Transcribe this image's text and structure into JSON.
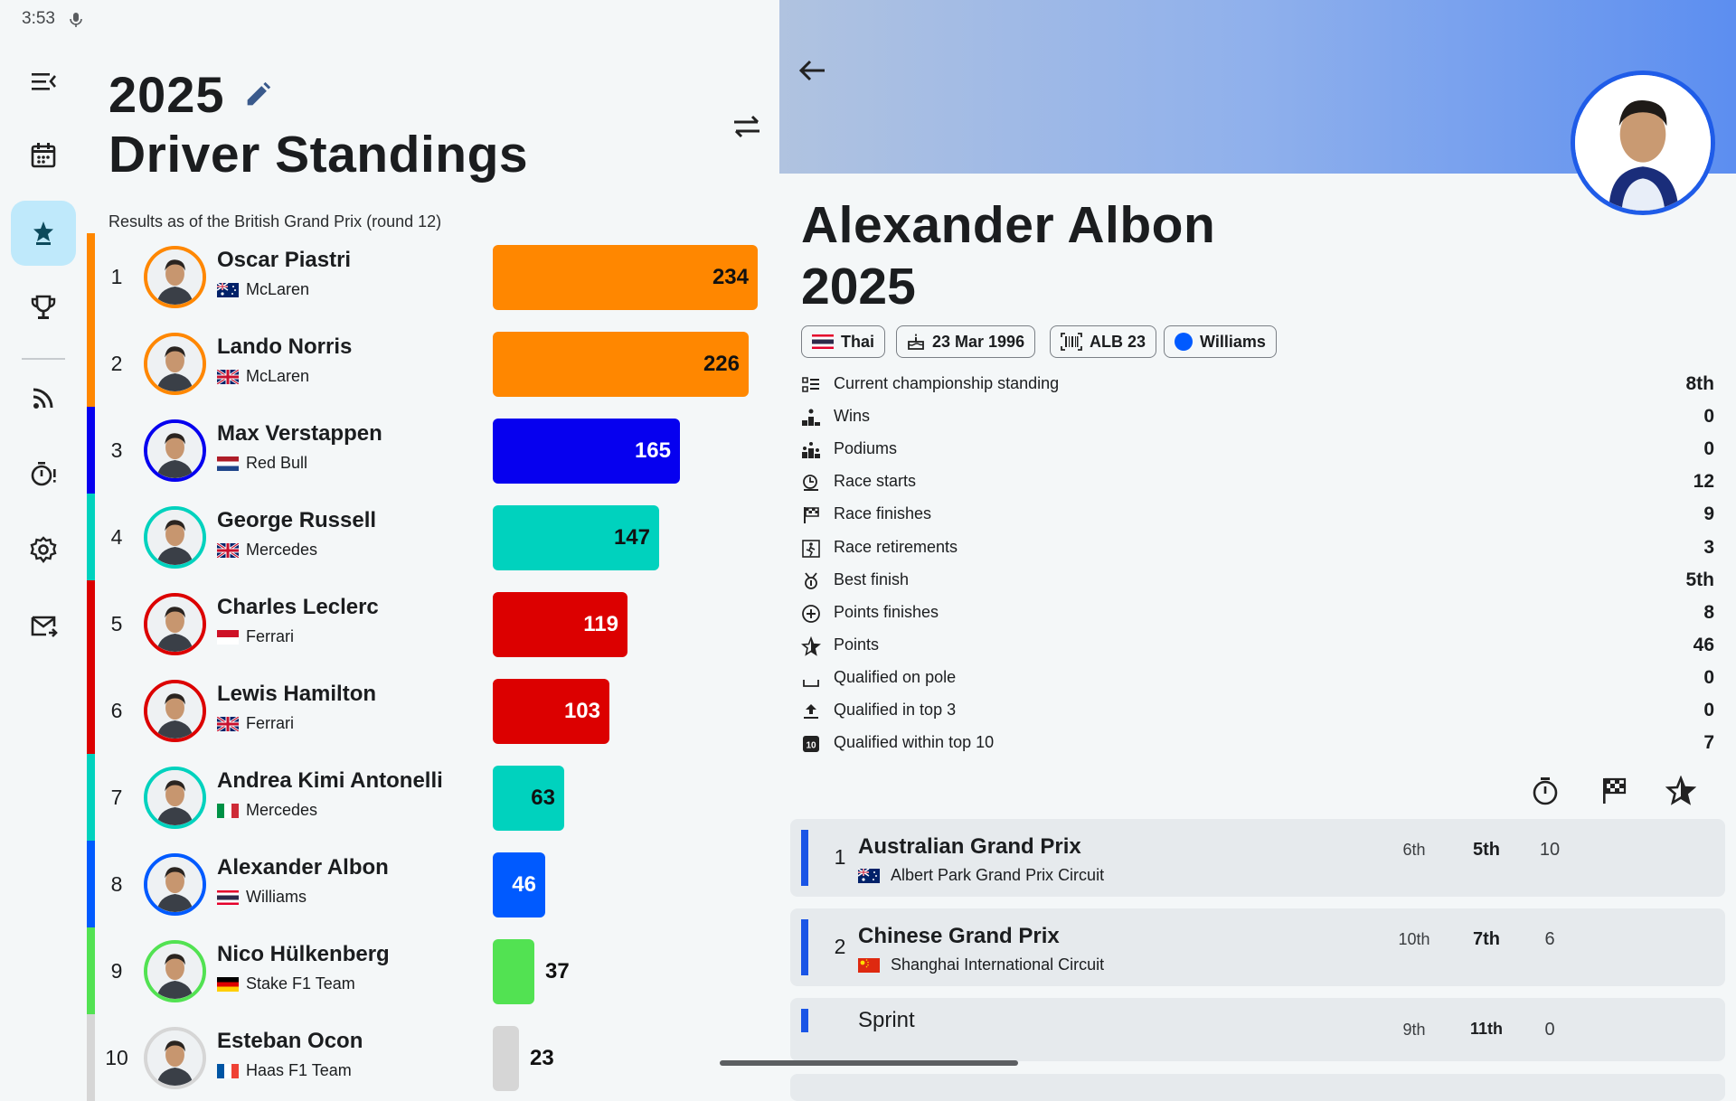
{
  "status_bar": {
    "time": "3:53"
  },
  "navigation": {
    "items": [
      "menu",
      "calendar",
      "standings",
      "trophy",
      "feed",
      "timer",
      "settings",
      "mail"
    ],
    "active": "standings"
  },
  "standings": {
    "year": "2025",
    "title": "Driver Standings",
    "results_note": "Results as of the British Grand Prix (round 12)",
    "rows": [
      {
        "pos": "1",
        "name": "Oscar Piastri",
        "team": "McLaren",
        "flag": "AU",
        "points": "234",
        "color": "#ff8700",
        "label_inside": true
      },
      {
        "pos": "2",
        "name": "Lando Norris",
        "team": "McLaren",
        "flag": "GB",
        "points": "226",
        "color": "#ff8700",
        "label_inside": true
      },
      {
        "pos": "3",
        "name": "Max Verstappen",
        "team": "Red Bull",
        "flag": "NL",
        "points": "165",
        "color": "#0600ef",
        "label_inside": true
      },
      {
        "pos": "4",
        "name": "George Russell",
        "team": "Mercedes",
        "flag": "GB",
        "points": "147",
        "color": "#00d2be",
        "label_inside": true
      },
      {
        "pos": "5",
        "name": "Charles Leclerc",
        "team": "Ferrari",
        "flag": "MC",
        "points": "119",
        "color": "#dc0000",
        "label_inside": true
      },
      {
        "pos": "6",
        "name": "Lewis Hamilton",
        "team": "Ferrari",
        "flag": "GB",
        "points": "103",
        "color": "#dc0000",
        "label_inside": true
      },
      {
        "pos": "7",
        "name": "Andrea Kimi Antonelli",
        "team": "Mercedes",
        "flag": "IT",
        "points": "63",
        "color": "#00d2be",
        "label_inside": true
      },
      {
        "pos": "8",
        "name": "Alexander Albon",
        "team": "Williams",
        "flag": "TH",
        "points": "46",
        "color": "#005aff",
        "label_inside": true
      },
      {
        "pos": "9",
        "name": "Nico Hülkenberg",
        "team": "Stake F1 Team",
        "flag": "DE",
        "points": "37",
        "color": "#52e252",
        "label_inside": false
      },
      {
        "pos": "10",
        "name": "Esteban Ocon",
        "team": "Haas F1 Team",
        "flag": "FR",
        "points": "23",
        "color": "#d6d6d6",
        "label_inside": false
      }
    ]
  },
  "driver": {
    "name": "Alexander Albon",
    "year": "2025",
    "chips": [
      {
        "label": "Thai",
        "icon": "thailand-flag-icon"
      },
      {
        "label": "23 Mar 1996",
        "icon": "cake-icon"
      },
      {
        "label": "ALB 23",
        "icon": "barcode-icon"
      },
      {
        "label": "Williams",
        "icon": "team-color-dot",
        "color": "#005aff"
      }
    ],
    "stats": [
      {
        "label": "Current championship standing",
        "value": "8th"
      },
      {
        "label": "Wins",
        "value": "0"
      },
      {
        "label": "Podiums",
        "value": "0"
      },
      {
        "label": "Race starts",
        "value": "12"
      },
      {
        "label": "Race finishes",
        "value": "9"
      },
      {
        "label": "Race retirements",
        "value": "3"
      },
      {
        "label": "Best finish",
        "value": "5th"
      },
      {
        "label": "Points finishes",
        "value": "8"
      },
      {
        "label": "Points",
        "value": "46"
      },
      {
        "label": "Qualified on pole",
        "value": "0"
      },
      {
        "label": "Qualified in top 3",
        "value": "0"
      },
      {
        "label": "Qualified within top 10",
        "value": "7"
      }
    ],
    "races": [
      {
        "round": "1",
        "name": "Australian Grand Prix",
        "circuit": "Albert Park Grand Prix Circuit",
        "flag": "AU",
        "qualifying": "6th",
        "finish": "5th",
        "points": "10"
      },
      {
        "round": "2",
        "name": "Chinese Grand Prix",
        "circuit": "Shanghai International Circuit",
        "flag": "CN",
        "qualifying": "10th",
        "finish": "7th",
        "points": "6"
      }
    ],
    "sprint": {
      "label": "Sprint",
      "qualifying": "9th",
      "finish": "11th",
      "points": "0"
    }
  }
}
